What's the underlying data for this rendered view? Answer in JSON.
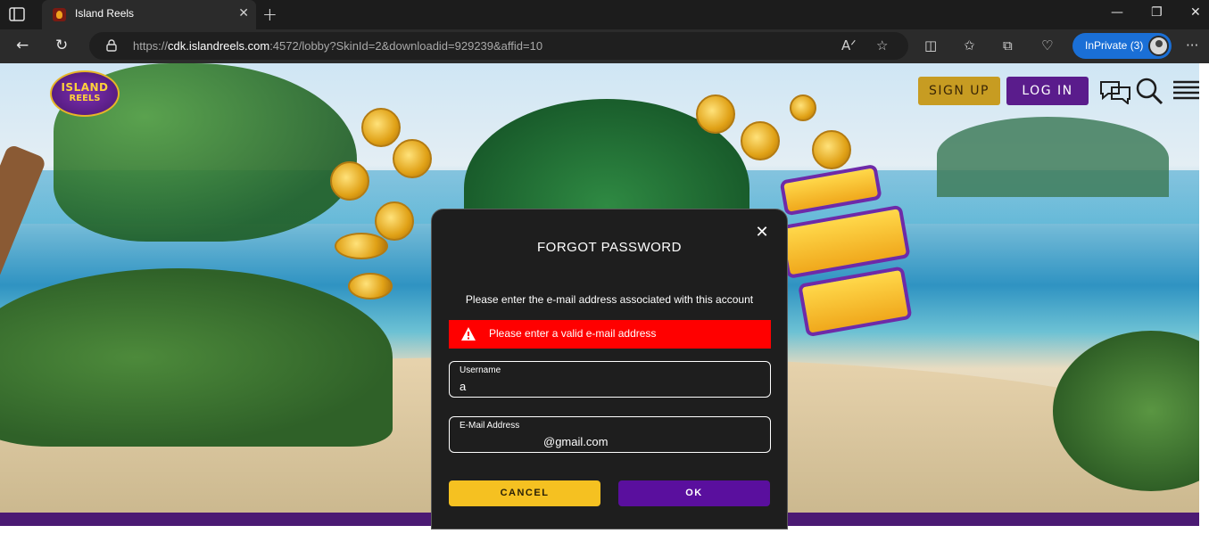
{
  "browser": {
    "tab_title": "Island Reels",
    "tab_close": "✕",
    "new_tab": "+",
    "url_host": "cdk.islandreels.com",
    "url_prefix": "https://",
    "url_rest": ":4572/lobby?SkinId=2&downloadid=929239&affid=10",
    "inprivate_label": "InPrivate (3)",
    "window_controls": {
      "minimize": "—",
      "maximize": "❐",
      "close": "✕"
    }
  },
  "site": {
    "logo_line1": "ISLAND",
    "logo_line2": "REELS",
    "signup_label": "SIGN UP",
    "login_label": "LOG IN",
    "colors": {
      "signup": "#c79c22",
      "login": "#5a1c8c",
      "footer": "#4b1a73"
    }
  },
  "modal": {
    "title": "FORGOT PASSWORD",
    "close_label": "✕",
    "description": "Please enter the e-mail address associated with this account",
    "error_message": "Please enter a valid e-mail address",
    "username_label": "Username",
    "username_value": "a",
    "email_label": "E-Mail Address",
    "email_value": "@gmail.com",
    "cancel_label": "CANCEL",
    "ok_label": "OK",
    "colors": {
      "error": "#ff0000",
      "cancel": "#f5c121",
      "ok": "#5a0f9e",
      "background": "#1e1e1e"
    }
  }
}
